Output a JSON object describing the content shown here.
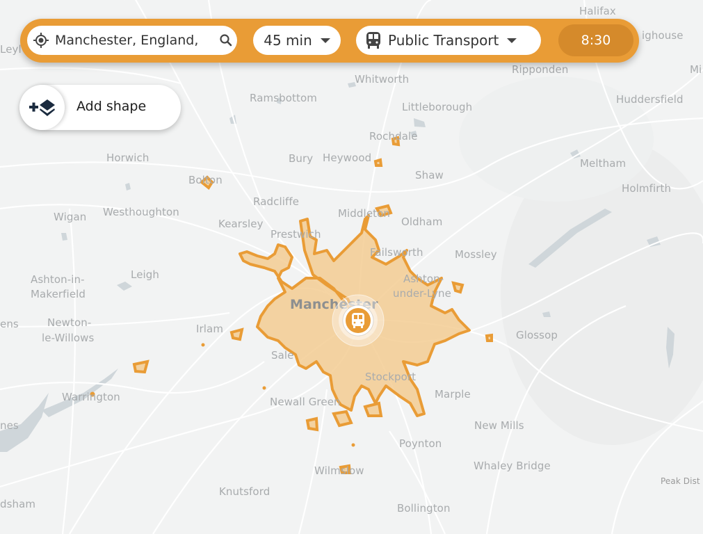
{
  "toolbar": {
    "location_value": "Manchester, England,",
    "duration": "45 min",
    "transport_mode": "Public Transport",
    "departure_time": "8:30",
    "accent_color": "#e99c36",
    "time_button_color": "#d58a2b"
  },
  "add_shape": {
    "label": "Add shape"
  },
  "marker": {
    "type": "train-station",
    "label": "Manchester origin"
  },
  "isochrone": {
    "fill_color": "#f3c98c",
    "stroke_color": "#e99c36",
    "minutes": 45
  },
  "map": {
    "labels": [
      {
        "text": "Halifax"
      },
      {
        "text": "ighouse"
      },
      {
        "text": "Ripponden"
      },
      {
        "text": "Mi"
      },
      {
        "text": "Leyl"
      },
      {
        "text": "Whitworth"
      },
      {
        "text": "Ramsbottom"
      },
      {
        "text": "Littleborough"
      },
      {
        "text": "Huddersfield"
      },
      {
        "text": "Rochdale"
      },
      {
        "text": "Horwich"
      },
      {
        "text": "Bury"
      },
      {
        "text": "Heywood"
      },
      {
        "text": "Shaw"
      },
      {
        "text": "Meltham"
      },
      {
        "text": "Bolton"
      },
      {
        "text": "Holmfirth"
      },
      {
        "text": "Radcliffe"
      },
      {
        "text": "Wigan"
      },
      {
        "text": "Westhoughton"
      },
      {
        "text": "Middleton"
      },
      {
        "text": "Oldham"
      },
      {
        "text": "Kearsley"
      },
      {
        "text": "Prestwich"
      },
      {
        "text": "Failsworth"
      },
      {
        "text": "Mossley"
      },
      {
        "text": "Ashton-in-"
      },
      {
        "text": "Makerfield"
      },
      {
        "text": "Leigh"
      },
      {
        "text": "Ashton-"
      },
      {
        "text": "under-Lyne"
      },
      {
        "text": "Manchester"
      },
      {
        "text": "ens"
      },
      {
        "text": "Newton-"
      },
      {
        "text": "le-Willows"
      },
      {
        "text": "Irlam"
      },
      {
        "text": "Glossop"
      },
      {
        "text": "Sale"
      },
      {
        "text": "Stockport"
      },
      {
        "text": "Marple"
      },
      {
        "text": "Warrington"
      },
      {
        "text": "Newall Green"
      },
      {
        "text": "nes"
      },
      {
        "text": "New Mills"
      },
      {
        "text": "Poynton"
      },
      {
        "text": "Whaley Bridge"
      },
      {
        "text": "Wilmslow"
      },
      {
        "text": "Peak Dist"
      },
      {
        "text": "Knutsford"
      },
      {
        "text": "dsham"
      },
      {
        "text": "Bollington"
      }
    ]
  }
}
